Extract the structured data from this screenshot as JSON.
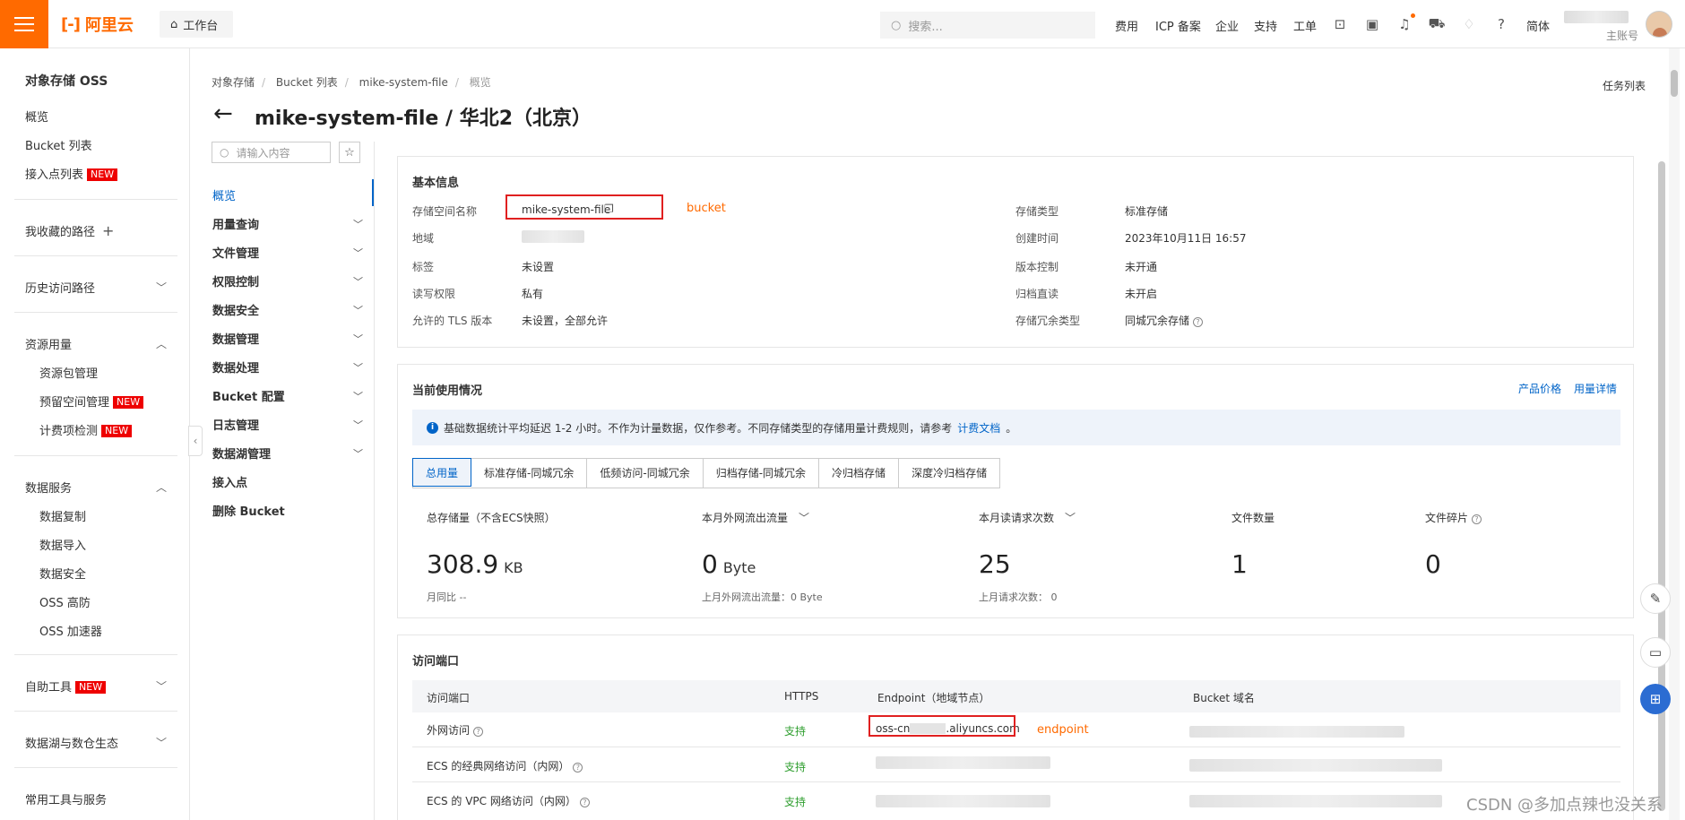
{
  "topbar": {
    "brand": "阿里云",
    "workbench": "工作台",
    "search_placeholder": "搜索...",
    "nav": [
      "费用",
      "ICP 备案",
      "企业",
      "支持",
      "工单"
    ],
    "lang": "简体",
    "account_role": "主账号"
  },
  "sidebar": {
    "title": "对象存储 OSS",
    "items": [
      {
        "label": "概览"
      },
      {
        "label": "Bucket 列表"
      },
      {
        "label": "接入点列表",
        "badge": "NEW"
      }
    ],
    "favorites": "我收藏的路径",
    "history": "历史访问路径",
    "resource_usage": {
      "label": "资源用量",
      "children": [
        {
          "label": "资源包管理"
        },
        {
          "label": "预留空间管理",
          "badge": "NEW"
        },
        {
          "label": "计费项检测",
          "badge": "NEW"
        }
      ]
    },
    "data_services": {
      "label": "数据服务",
      "children": [
        {
          "label": "数据复制"
        },
        {
          "label": "数据导入"
        },
        {
          "label": "数据安全"
        },
        {
          "label": "OSS 高防"
        },
        {
          "label": "OSS 加速器"
        }
      ]
    },
    "self_tools": {
      "label": "自助工具",
      "badge": "NEW"
    },
    "datalake": "数据湖与数仓生态",
    "more": "常用工具与服务"
  },
  "breadcrumb": [
    "对象存储",
    "Bucket 列表",
    "mike-system-file",
    "概览"
  ],
  "task_list": "任务列表",
  "page_title": "mike-system-file / 华北2（北京）",
  "subnav": {
    "search_placeholder": "请输入内容",
    "items": [
      {
        "label": "概览",
        "active": true
      },
      {
        "label": "用量查询",
        "chevron": true
      },
      {
        "label": "文件管理",
        "chevron": true
      },
      {
        "label": "权限控制",
        "chevron": true
      },
      {
        "label": "数据安全",
        "chevron": true
      },
      {
        "label": "数据管理",
        "chevron": true
      },
      {
        "label": "数据处理",
        "chevron": true
      },
      {
        "label": "Bucket 配置",
        "chevron": true
      },
      {
        "label": "日志管理",
        "chevron": true
      },
      {
        "label": "数据湖管理",
        "chevron": true
      },
      {
        "label": "接入点",
        "chevron": false
      },
      {
        "label": "删除 Bucket",
        "chevron": false
      }
    ]
  },
  "basic_info": {
    "title": "基本信息",
    "left": [
      {
        "label": "存储空间名称",
        "value": "mike-system-file"
      },
      {
        "label": "地域",
        "value": ""
      },
      {
        "label": "标签",
        "value": "未设置"
      },
      {
        "label": "读写权限",
        "value": "私有"
      },
      {
        "label": "允许的 TLS 版本",
        "value": "未设置，全部允许"
      }
    ],
    "right": [
      {
        "label": "存储类型",
        "value": "标准存储"
      },
      {
        "label": "创建时间",
        "value": "2023年10月11日 16:57"
      },
      {
        "label": "版本控制",
        "value": "未开通"
      },
      {
        "label": "归档直读",
        "value": "未开启"
      },
      {
        "label": "存储冗余类型",
        "value": "同城冗余存储"
      }
    ],
    "annotation": "bucket"
  },
  "usage": {
    "title": "当前使用情况",
    "links": [
      "产品价格",
      "用量详情"
    ],
    "notice_text": "基础数据统计平均延迟 1-2 小时。不作为计量数据，仅作参考。不同存储类型的存储用量计费规则，请参考",
    "notice_link": "计费文档",
    "notice_end": "。",
    "tabs": [
      "总用量",
      "标准存储-同城冗余",
      "低频访问-同城冗余",
      "归档存储-同城冗余",
      "冷归档存储",
      "深度冷归档存储"
    ],
    "stats": [
      {
        "label": "总存储量（不含ECS快照）",
        "value": "308.9",
        "unit": "KB",
        "sub": "月同比 --"
      },
      {
        "label": "本月外网流出流量",
        "value": "0",
        "unit": "Byte",
        "sub": "上月外网流出流量：0 Byte"
      },
      {
        "label": "本月读请求次数",
        "value": "25",
        "unit": "",
        "sub": "上月请求次数：  0"
      },
      {
        "label": "文件数量",
        "value": "1",
        "unit": "",
        "sub": ""
      },
      {
        "label": "文件碎片",
        "value": "0",
        "unit": "",
        "sub": ""
      }
    ]
  },
  "access": {
    "title": "访问端口",
    "columns": [
      "访问端口",
      "HTTPS",
      "Endpoint（地域节点）",
      "Bucket 域名"
    ],
    "rows": [
      {
        "port": "外网访问",
        "https": "支持",
        "endpoint": "oss-cn",
        "endpoint_tail": ".aliyuncs.com"
      },
      {
        "port": "ECS 的经典网络访问（内网）",
        "https": "支持",
        "endpoint": "",
        "endpoint_tail": ""
      },
      {
        "port": "ECS 的 VPC 网络访问（内网）",
        "https": "支持",
        "endpoint": "",
        "endpoint_tail": ""
      }
    ],
    "annotation": "endpoint"
  },
  "watermark": "CSDN @多加点辣也没关系",
  "colors": {
    "brand": "#ff6a00",
    "link": "#0064c8",
    "annotation_box": "#e02020",
    "support_green": "#2e9e2e"
  }
}
